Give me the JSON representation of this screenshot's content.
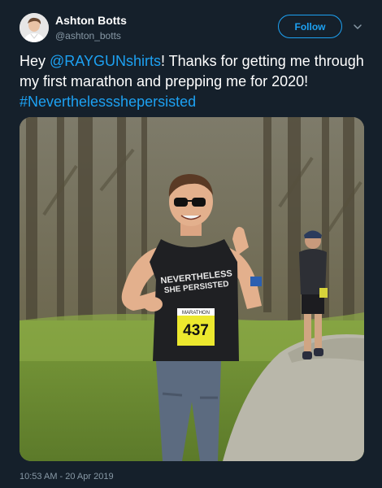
{
  "user": {
    "display_name": "Ashton Botts",
    "handle": "@ashton_botts"
  },
  "follow_label": "Follow",
  "tweet": {
    "part1": "Hey ",
    "mention": "@RAYGUNshirts",
    "part2": "! Thanks for getting me through my first marathon and prepping me for 2020! ",
    "hashtag": "#Neverthelessshepersisted"
  },
  "photo": {
    "shirt_line1": "NEVERTHELESS",
    "shirt_line2": "SHE PERSISTED",
    "bib_top": "MARATHON",
    "bib_number": "437"
  },
  "timestamp": "10:53 AM - 20 Apr 2019",
  "colors": {
    "background": "#15202b",
    "accent": "#1da1f2",
    "secondary_text": "#8899a6"
  }
}
